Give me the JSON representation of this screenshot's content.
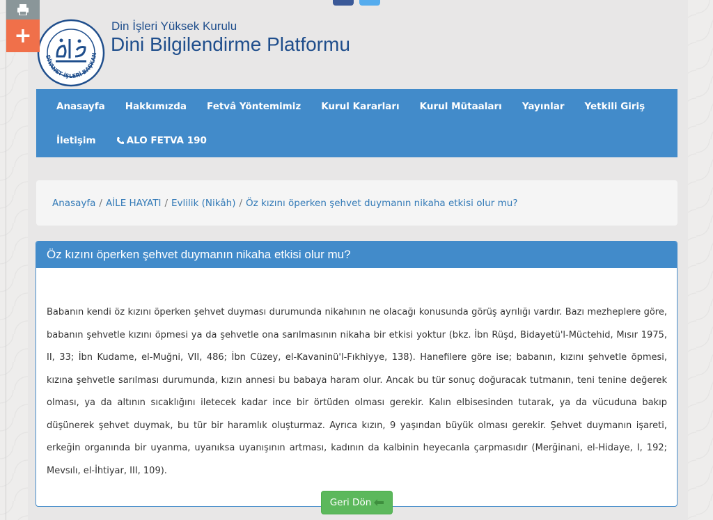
{
  "header": {
    "org_name": "Din İşleri Yüksek Kurulu",
    "platform_name": "Dini Bilgilendirme Platformu",
    "logo_text": "DİYANET İŞLERİ BAŞKANLIĞI"
  },
  "tools": {
    "print_icon": "printer-icon",
    "plus_label": "+"
  },
  "nav": {
    "items": [
      {
        "label": "Anasayfa"
      },
      {
        "label": "Hakkımızda"
      },
      {
        "label": "Fetvâ Yöntemimiz"
      },
      {
        "label": "Kurul Kararları"
      },
      {
        "label": "Kurul Mütaaları"
      },
      {
        "label": "Yayınlar"
      },
      {
        "label": "Yetkili Giriş"
      },
      {
        "label": "İletişim"
      },
      {
        "label": "ALO FETVA 190"
      }
    ]
  },
  "breadcrumb": {
    "items": [
      "Anasayfa",
      "AİLE HAYATI",
      "Evlilik (Nikâh)"
    ],
    "current": "Öz kızını öperken şehvet duymanın nikaha etkisi olur mu?"
  },
  "article": {
    "title": "Öz kızını öperken şehvet duymanın nikaha etkisi olur mu?",
    "body": "Babanın kendi öz kızını öperken şehvet duyması durumunda nikahının ne olacağı konusunda görüş ayrılığı vardır. Bazı mezheplere göre, babanın şehvetle kızını öpmesi ya da şehvetle ona sarılmasının nikaha bir etkisi yoktur (bkz. İbn Rüşd, Bidayetü'l-Müctehid, Mısır 1975, II, 33; İbn Kudame, el-Muğni, VII, 486; İbn Cüzey, el-Kavaninü'l-Fıkhiyye, 138). Hanefilere göre ise; babanın, kızını şehvetle öpmesi, kızına şehvetle sarılması durumunda, kızın annesi bu babaya haram olur. Ancak bu tür sonuç doğuracak tutmanın, teni tenine değerek olması, ya da altının sıcaklığını iletecek kadar ince bir örtüden olması gerekir. Kalın elbisesinden tutarak, ya da vücuduna bakıp düşünerek şehvet duymak, bu tür bir haramlık oluşturmaz. Ayrıca kızın, 9 yaşından büyük olması gerekir. Şehvet duymanın işareti, erkeğin organında bir uyanma, uyanıksa uyanışının artması, kadının da kalbinin heyecanla çarpmasıdır (Merğinani, el-Hidaye, I, 192; Mevsılı, el-İhtiyar, III, 109).",
    "back_button": "Geri Dön"
  },
  "colors": {
    "nav_bg": "#428bca",
    "button_green": "#5cb85c",
    "plus_orange": "#f0704a",
    "brand_blue": "#1f4e8c"
  }
}
